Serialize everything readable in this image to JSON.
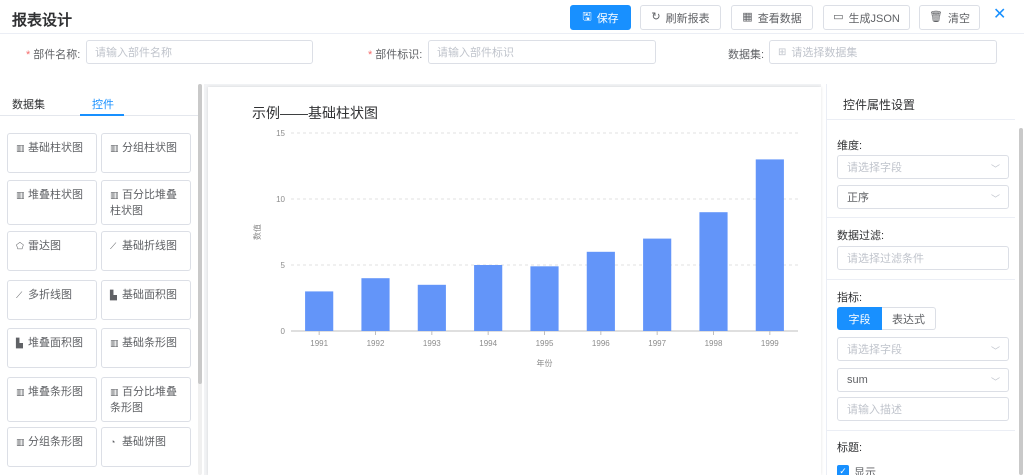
{
  "header": {
    "title": "报表设计",
    "buttons": {
      "save": "保存",
      "refresh": "刷新报表",
      "view_data": "查看数据",
      "gen_json": "生成JSON",
      "clear": "清空"
    },
    "close": "✕"
  },
  "form": {
    "name_label": "部件名称:",
    "name_placeholder": "请输入部件名称",
    "id_label": "部件标识:",
    "id_placeholder": "请输入部件标识",
    "dataset_label": "数据集:",
    "dataset_placeholder": "请选择数据集"
  },
  "left": {
    "tabs": [
      "数据集",
      "控件"
    ],
    "widgets": [
      {
        "label": "基础柱状图",
        "icon": "bar-chart-icon"
      },
      {
        "label": "分组柱状图",
        "icon": "bar-chart-icon"
      },
      {
        "label": "堆叠柱状图",
        "icon": "bar-chart-icon"
      },
      {
        "label": "百分比堆叠柱状图",
        "icon": "bar-chart-icon"
      },
      {
        "label": "雷达图",
        "icon": "radar-chart-icon"
      },
      {
        "label": "基础折线图",
        "icon": "line-chart-icon"
      },
      {
        "label": "多折线图",
        "icon": "line-chart-icon"
      },
      {
        "label": "基础面积图",
        "icon": "area-chart-icon"
      },
      {
        "label": "堆叠面积图",
        "icon": "area-chart-icon"
      },
      {
        "label": "基础条形图",
        "icon": "bar-chart-icon"
      },
      {
        "label": "堆叠条形图",
        "icon": "bar-chart-icon"
      },
      {
        "label": "百分比堆叠条形图",
        "icon": "bar-chart-icon"
      },
      {
        "label": "分组条形图",
        "icon": "bar-chart-icon"
      },
      {
        "label": "基础饼图",
        "icon": "pie-chart-icon"
      }
    ]
  },
  "right": {
    "title": "控件属性设置",
    "dimension_label": "维度:",
    "dimension_field_placeholder": "请选择字段",
    "dimension_order": "正序",
    "filter_label": "数据过滤:",
    "filter_placeholder": "请选择过滤条件",
    "metric_label": "指标:",
    "metric_tabs": [
      "字段",
      "表达式"
    ],
    "metric_field_placeholder": "请选择字段",
    "metric_agg": "sum",
    "metric_desc_placeholder": "请输入描述",
    "title_label": "标题:",
    "show_label": "显示"
  },
  "chart_data": {
    "type": "bar",
    "title": "示例——基础柱状图",
    "xlabel": "年份",
    "ylabel": "数值",
    "categories": [
      "1991",
      "1992",
      "1993",
      "1994",
      "1995",
      "1996",
      "1997",
      "1998",
      "1999"
    ],
    "values": [
      3,
      4,
      3.5,
      5,
      4.9,
      6,
      7,
      9,
      13
    ],
    "ylim": [
      0,
      15
    ],
    "yticks": [
      0,
      5,
      10,
      15
    ],
    "grid": true,
    "color": "#6395f9"
  }
}
